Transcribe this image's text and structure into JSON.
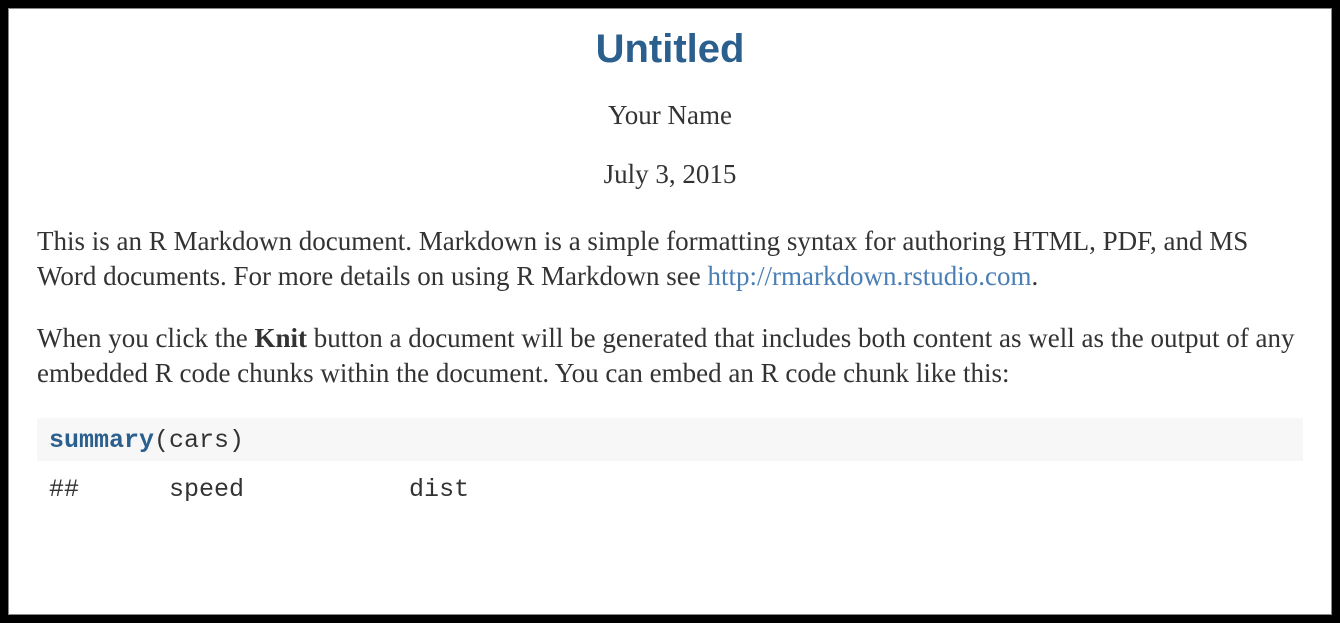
{
  "header": {
    "title": "Untitled",
    "author": "Your Name",
    "date": "July 3, 2015"
  },
  "intro": {
    "text_before_link": "This is an R Markdown document. Markdown is a simple formatting syntax for authoring HTML, PDF, and MS Word documents. For more details on using R Markdown see ",
    "link_text": "http://rmarkdown.rstudio.com",
    "link_href": "http://rmarkdown.rstudio.com",
    "text_after_link": "."
  },
  "knit": {
    "text_before_bold": "When you click the ",
    "bold_text": "Knit",
    "text_after_bold": " button a document will be generated that includes both content as well as the output of any embedded R code chunks within the document. You can embed an R code chunk like this:"
  },
  "code": {
    "fn": "summary",
    "rest": "(cars)"
  },
  "output_line": "##      speed           dist"
}
